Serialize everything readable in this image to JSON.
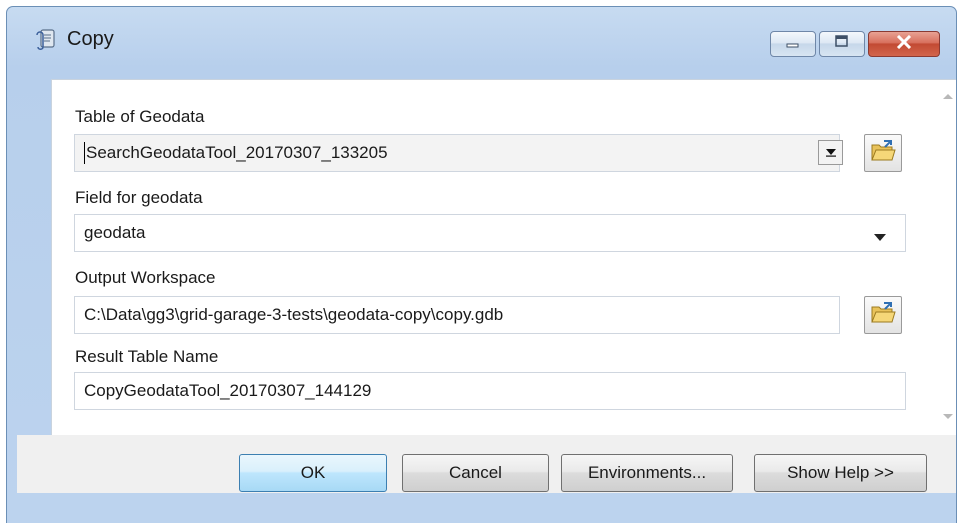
{
  "window": {
    "title": "Copy",
    "app_icon": "script-tool-icon",
    "controls": {
      "minimize": "minimize-icon",
      "maximize": "maximize-icon",
      "close": "close-icon"
    }
  },
  "fields": {
    "table_of_geodata": {
      "label": "Table of Geodata",
      "value": "SearchGeodataTool_20170307_133205"
    },
    "field_for_geodata": {
      "label": "Field for geodata",
      "value": "geodata"
    },
    "output_workspace": {
      "label": "Output Workspace",
      "value": "C:\\Data\\gg3\\grid-garage-3-tests\\geodata-copy\\copy.gdb"
    },
    "result_table_name": {
      "label": "Result Table Name",
      "value": "CopyGeodataTool_20170307_144129"
    }
  },
  "buttons": {
    "ok": "OK",
    "cancel": "Cancel",
    "environments": "Environments...",
    "show_help": "Show Help >>"
  },
  "colors": {
    "title_bar": "#bcd3ee",
    "close_button": "#c94f3a",
    "ok_button_border": "#3c7fb1"
  }
}
